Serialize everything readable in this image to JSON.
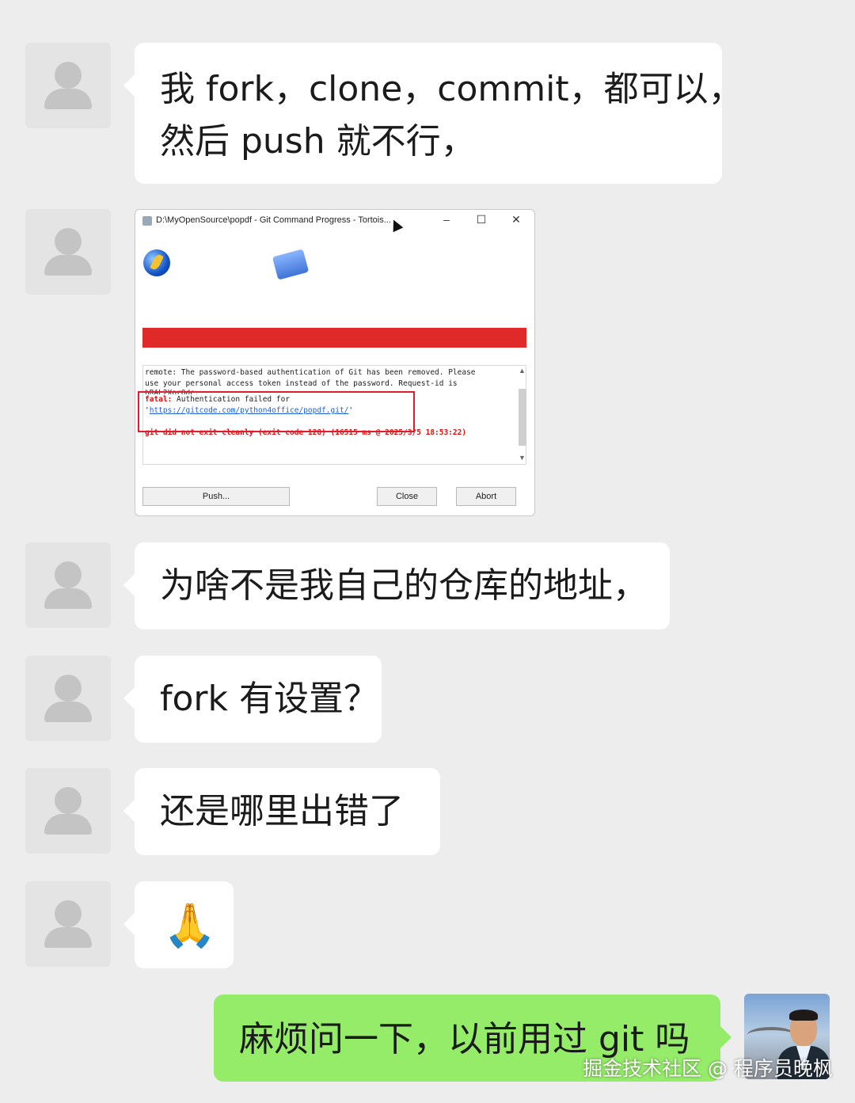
{
  "messages": [
    {
      "type": "text",
      "text_line1": "我 fork，clone，commit，都可以，",
      "text_line2": "然后 push 就不行，"
    },
    {
      "type": "screenshot"
    },
    {
      "type": "text",
      "text": "为啥不是我自己的仓库的地址，"
    },
    {
      "type": "text",
      "text": "fork 有设置？"
    },
    {
      "type": "text",
      "text": "还是哪里出错了"
    },
    {
      "type": "emoji",
      "text": "🙏"
    }
  ],
  "reply": {
    "text": "麻烦问一下，以前用过 git 吗"
  },
  "screenshot": {
    "window_title": "D:\\MyOpenSource\\popdf - Git Command Progress - Tortois...",
    "window_controls": {
      "minimize": "–",
      "maximize": "☐",
      "close": "✕"
    },
    "log_lines": {
      "line1": "remote: The password-based authentication of Git has been removed. Please",
      "line2": "use your personal access token instead of the password. Request-id is",
      "line3": "bRAL2XorQde.",
      "fatal_label": "fatal:",
      "fatal_text": " Authentication failed for",
      "url_prefix": "'",
      "url": "https://gitcode.com/python4office/popdf.git/",
      "url_suffix": "'",
      "error_line": "git did not exit cleanly (exit code 128) (16515 ms @ 2025/3/5 18:53:22)"
    },
    "buttons": {
      "push": "Push...",
      "close": "Close",
      "abort": "Abort"
    },
    "progress_color": "#e02a2a"
  },
  "watermark": "掘金技术社区 @ 程序员晚枫",
  "colors": {
    "background": "#ededed",
    "bubble": "#ffffff",
    "my_bubble": "#95ec69"
  }
}
